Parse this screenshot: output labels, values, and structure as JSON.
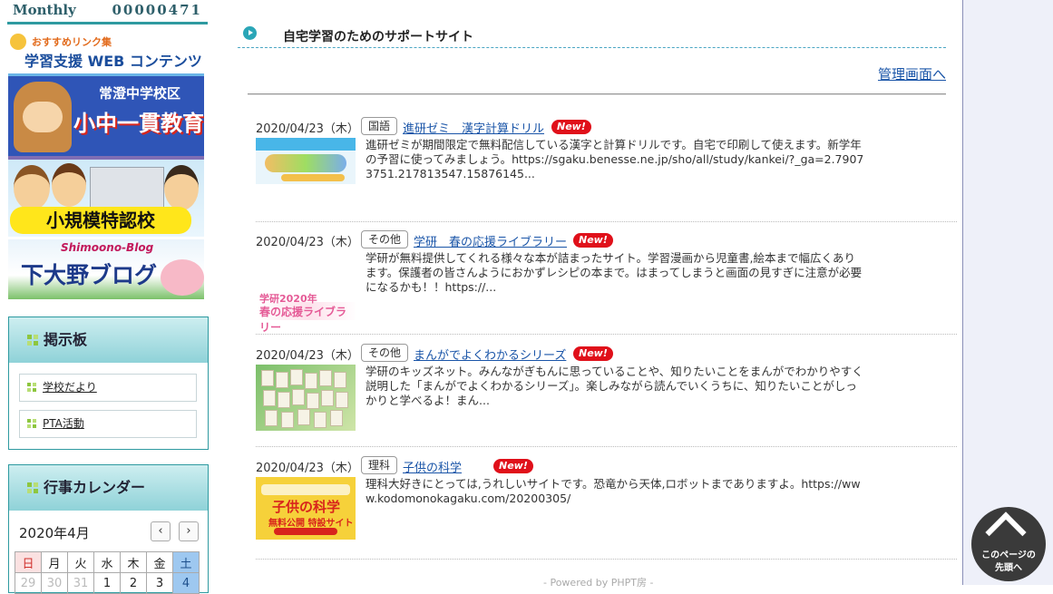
{
  "counter": {
    "label": "Monthly",
    "value": "00000471"
  },
  "banners": {
    "links": {
      "top": "おすすめリンク集",
      "main": "学習支援 WEB コンテンツ"
    },
    "ikkan": {
      "top": "常澄中学校区",
      "main": "小中一貫教育"
    },
    "tokunin": {
      "main": "小規模特認校"
    },
    "blog": {
      "top": "Shimoono-Blog",
      "main": "下大野ブログ"
    }
  },
  "bbs": {
    "title": "掲示板",
    "items": [
      {
        "label": "学校だより"
      },
      {
        "label": "PTA活動"
      }
    ]
  },
  "calendar": {
    "title": "行事カレンダー",
    "month": "2020年4月",
    "prev": "‹",
    "next": "›",
    "weekdays": [
      "日",
      "月",
      "火",
      "水",
      "木",
      "金",
      "土"
    ],
    "first_row": [
      "29",
      "30",
      "31",
      "1",
      "2",
      "3",
      "4"
    ]
  },
  "main": {
    "title": "自宅学習のためのサポートサイト",
    "admin_link": "管理画面へ",
    "entries": [
      {
        "date": "2020/04/23（木）",
        "category": "国語",
        "title": "進研ゼミ　漢字計算ドリル",
        "badge": "New!",
        "desc": "進研ゼミが期間限定で無料配信している漢字と計算ドリルです。自宅で印刷して使えます。新学年の予習に使ってみましょう。https://sgaku.benesse.ne.jp/sho/all/study/kankei/?_ga=2.79073751.217813547.15876145..."
      },
      {
        "date": "2020/04/23（木）",
        "category": "その他",
        "title": "学研　春の応援ライブラリー",
        "badge": "New!",
        "thumb_text": "学研2020年",
        "thumb_text2": "春の応援ライブラリー",
        "desc": "学研が無料提供してくれる様々な本が詰まったサイト。学習漫画から児童書,絵本まで幅広くあります。保護者の皆さんようにおかずレシピの本まで。はまってしまうと画面の見すぎに注意が必要になるかも！！https://..."
      },
      {
        "date": "2020/04/23（木）",
        "category": "その他",
        "title": "まんがでよくわかるシリーズ",
        "badge": "New!",
        "desc": "学研のキッズネット。みんながぎもんに思っていることや、知りたいことをまんがでわかりやすく説明した「まんがでよくわかるシリーズ」。楽しみながら読んでいくうちに、知りたいことがしっかりと学べるよ！まん..."
      },
      {
        "date": "2020/04/23（木）",
        "category": "理科",
        "title": "子供の科学",
        "badge": "New!",
        "thumb_text": "子供の科学",
        "thumb_text2": "無料公開 特設サイト",
        "desc": "理科大好きにとっては,うれしいサイトです。恐竜から天体,ロボットまでありますよ。https://www.kodomonokagaku.com/20200305/"
      }
    ],
    "powered": "- Powered by PHPT房 -"
  },
  "to_top": {
    "line1": "このページの",
    "line2": "先頭へ"
  }
}
